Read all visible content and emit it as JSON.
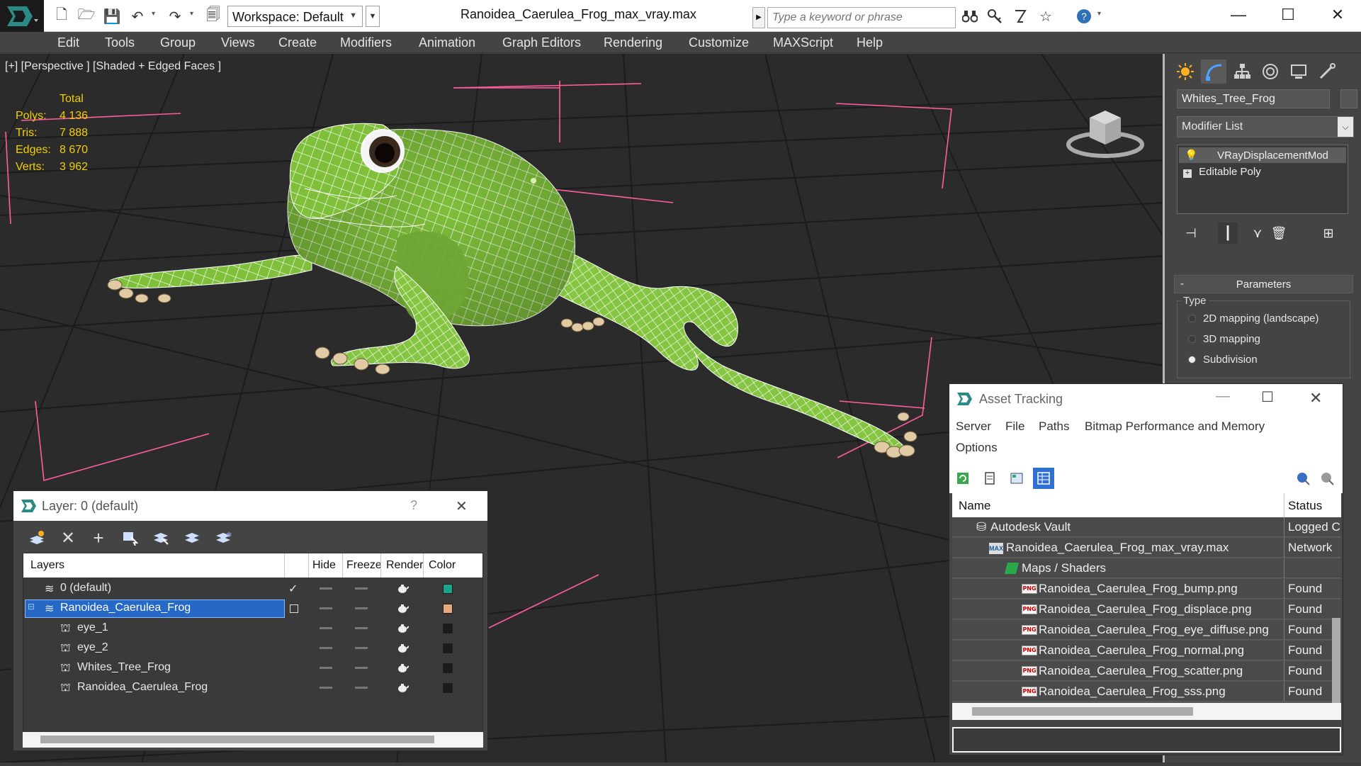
{
  "titlebar": {
    "workspace_label": "Workspace: Default",
    "file_name": "Ranoidea_Caerulea_Frog_max_vray.max",
    "search_placeholder": "Type a keyword or phrase",
    "minimize": "—",
    "maximize": "☐",
    "close": "✕"
  },
  "menu": [
    "Edit",
    "Tools",
    "Group",
    "Views",
    "Create",
    "Modifiers",
    "Animation",
    "Graph Editors",
    "Rendering",
    "Customize",
    "MAXScript",
    "Help"
  ],
  "viewport": {
    "label": "[+] [Perspective ] [Shaded + Edged Faces ]",
    "stats": {
      "header": "Total",
      "rows": [
        {
          "label": "Polys:",
          "value": "4 136"
        },
        {
          "label": "Tris:",
          "value": "7 888"
        },
        {
          "label": "Edges:",
          "value": "8 670"
        },
        {
          "label": "Verts:",
          "value": "3 962"
        }
      ]
    },
    "colors": {
      "bg": "#2b2b2b",
      "grid": "#1e1e1e",
      "wire": "#ffffff",
      "frog": "#7fbf3a",
      "bbox": "#ff5d9e"
    }
  },
  "command_panel": {
    "object_name": "Whites_Tree_Frog",
    "modifier_list": "Modifier List",
    "stack": [
      {
        "label": "VRayDisplacementMod",
        "selected": true
      },
      {
        "label": "Editable Poly",
        "selected": false
      }
    ],
    "rollout_title": "Parameters",
    "type_group": "Type",
    "type_options": [
      {
        "label": "2D mapping (landscape)",
        "checked": false
      },
      {
        "label": "3D mapping",
        "checked": false
      },
      {
        "label": "Subdivision",
        "checked": true
      }
    ]
  },
  "layer_window": {
    "title": "Layer: 0 (default)",
    "help": "?",
    "close": "✕",
    "columns": [
      "Layers",
      "Hide",
      "Freeze",
      "Render",
      "Color"
    ],
    "rows": [
      {
        "name": "0 (default)",
        "kind": "layer",
        "active": true,
        "color": "#1aa58a"
      },
      {
        "name": "Ranoidea_Caerulea_Frog",
        "kind": "layer",
        "selected": true,
        "color": "#e6a97c"
      },
      {
        "name": "eye_1",
        "kind": "object",
        "color": "#1c1c1c"
      },
      {
        "name": "eye_2",
        "kind": "object",
        "color": "#1c1c1c"
      },
      {
        "name": "Whites_Tree_Frog",
        "kind": "object",
        "color": "#1c1c1c"
      },
      {
        "name": "Ranoidea_Caerulea_Frog",
        "kind": "object",
        "color": "#1c1c1c"
      }
    ]
  },
  "asset_window": {
    "title": "Asset Tracking",
    "menu": [
      "Server",
      "File",
      "Paths",
      "Bitmap Performance and Memory",
      "Options"
    ],
    "columns": [
      "Name",
      "Status"
    ],
    "rows": [
      {
        "name": "Autodesk Vault",
        "status": "Logged C",
        "icon": "vault",
        "indent": 0
      },
      {
        "name": "Ranoidea_Caerulea_Frog_max_vray.max",
        "status": "Network",
        "icon": "max",
        "indent": 1
      },
      {
        "name": "Maps / Shaders",
        "status": "",
        "icon": "maps",
        "indent": 2
      },
      {
        "name": "Ranoidea_Caerulea_Frog_bump.png",
        "status": "Found",
        "icon": "png",
        "indent": 3
      },
      {
        "name": "Ranoidea_Caerulea_Frog_displace.png",
        "status": "Found",
        "icon": "png",
        "indent": 3
      },
      {
        "name": "Ranoidea_Caerulea_Frog_eye_diffuse.png",
        "status": "Found",
        "icon": "png",
        "indent": 3
      },
      {
        "name": "Ranoidea_Caerulea_Frog_normal.png",
        "status": "Found",
        "icon": "png",
        "indent": 3
      },
      {
        "name": "Ranoidea_Caerulea_Frog_scatter.png",
        "status": "Found",
        "icon": "png",
        "indent": 3
      },
      {
        "name": "Ranoidea_Caerulea_Frog_sss.png",
        "status": "Found",
        "icon": "png",
        "indent": 3
      }
    ],
    "png_badge": "PNG"
  }
}
